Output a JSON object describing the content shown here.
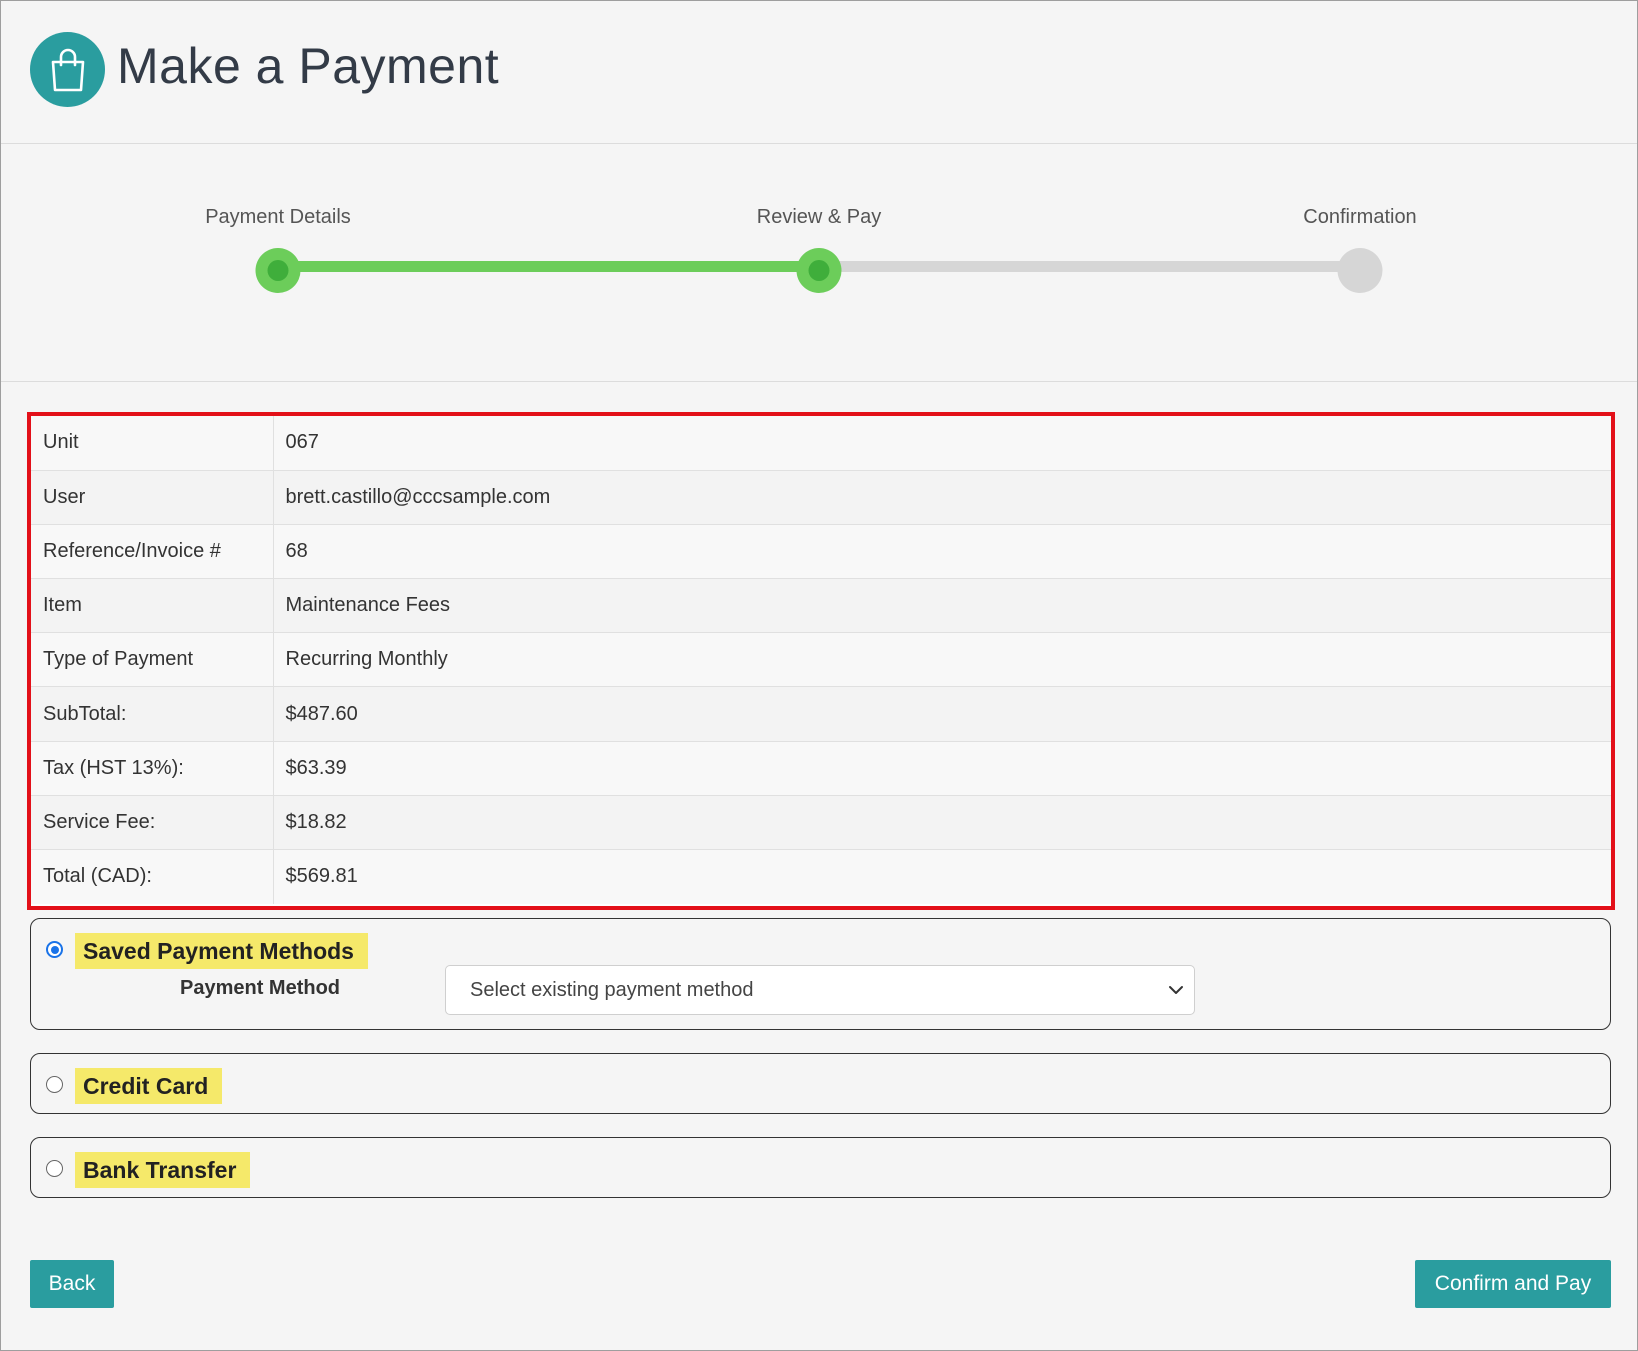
{
  "header": {
    "title": "Make a Payment",
    "logo_icon": "shopping-bag-icon"
  },
  "stepper": {
    "steps": [
      {
        "label": "Payment Details",
        "state": "complete"
      },
      {
        "label": "Review & Pay",
        "state": "current"
      },
      {
        "label": "Confirmation",
        "state": "pending"
      }
    ],
    "colors": {
      "complete": "#6ccd5a",
      "pending": "#d6d6d6"
    }
  },
  "summary": {
    "rows": [
      {
        "key": "Unit",
        "value": "067"
      },
      {
        "key": "User",
        "value": "brett.castillo@cccsample.com"
      },
      {
        "key": "Reference/Invoice #",
        "value": "68"
      },
      {
        "key": "Item",
        "value": "Maintenance Fees"
      },
      {
        "key": "Type of Payment",
        "value": "Recurring Monthly"
      },
      {
        "key": "SubTotal:",
        "value": "$487.60"
      },
      {
        "key": "Tax (HST 13%):",
        "value": "$63.39"
      },
      {
        "key": "Service Fee:",
        "value": "$18.82"
      },
      {
        "key": "Total (CAD):",
        "value": "$569.81"
      }
    ],
    "highlight_color": "#e31019"
  },
  "payment_options": {
    "saved": {
      "label": "Saved Payment Methods",
      "selected": true,
      "field_label": "Payment Method",
      "select_value": "Select existing payment method"
    },
    "credit_card": {
      "label": "Credit Card",
      "selected": false
    },
    "bank_transfer": {
      "label": "Bank Transfer",
      "selected": false
    },
    "highlight_color": "#f5e96a"
  },
  "actions": {
    "back_label": "Back",
    "confirm_label": "Confirm and Pay",
    "accent": "#2a9d9f"
  }
}
